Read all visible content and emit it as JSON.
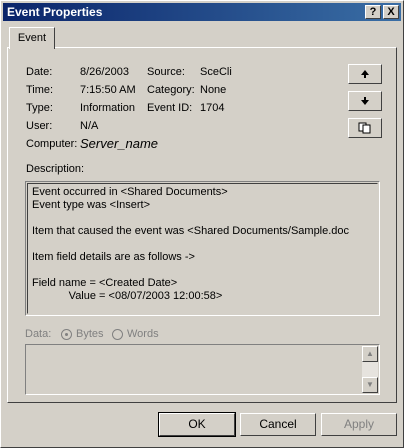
{
  "window": {
    "title": "Event Properties"
  },
  "titlebar_buttons": {
    "help": "?",
    "close": "X"
  },
  "tab": {
    "label": "Event"
  },
  "fields": {
    "date_label": "Date:",
    "date_value": "8/26/2003",
    "time_label": "Time:",
    "time_value": "7:15:50 AM",
    "type_label": "Type:",
    "type_value": "Information",
    "user_label": "User:",
    "user_value": "N/A",
    "computer_label": "Computer:",
    "computer_value": "Server_name",
    "source_label": "Source:",
    "source_value": "SceCli",
    "category_label": "Category:",
    "category_value": "None",
    "eventid_label": "Event ID:",
    "eventid_value": "1704"
  },
  "description": {
    "label": "Description:",
    "lines": [
      "Event occurred in <Shared Documents>",
      "Event type was <Insert>",
      "",
      "Item that caused the event was <Shared Documents/Sample.doc",
      "",
      "Item field details are as follows ->",
      "",
      "Field name = <Created Date>",
      "            Value = <08/07/2003 12:00:58>"
    ]
  },
  "data": {
    "label": "Data:",
    "bytes_label": "Bytes",
    "words_label": "Words",
    "selected": "Bytes"
  },
  "buttons": {
    "ok": "OK",
    "cancel": "Cancel",
    "apply": "Apply"
  },
  "icons": {
    "up": "arrow-up",
    "down": "arrow-down",
    "copy": "copy"
  }
}
